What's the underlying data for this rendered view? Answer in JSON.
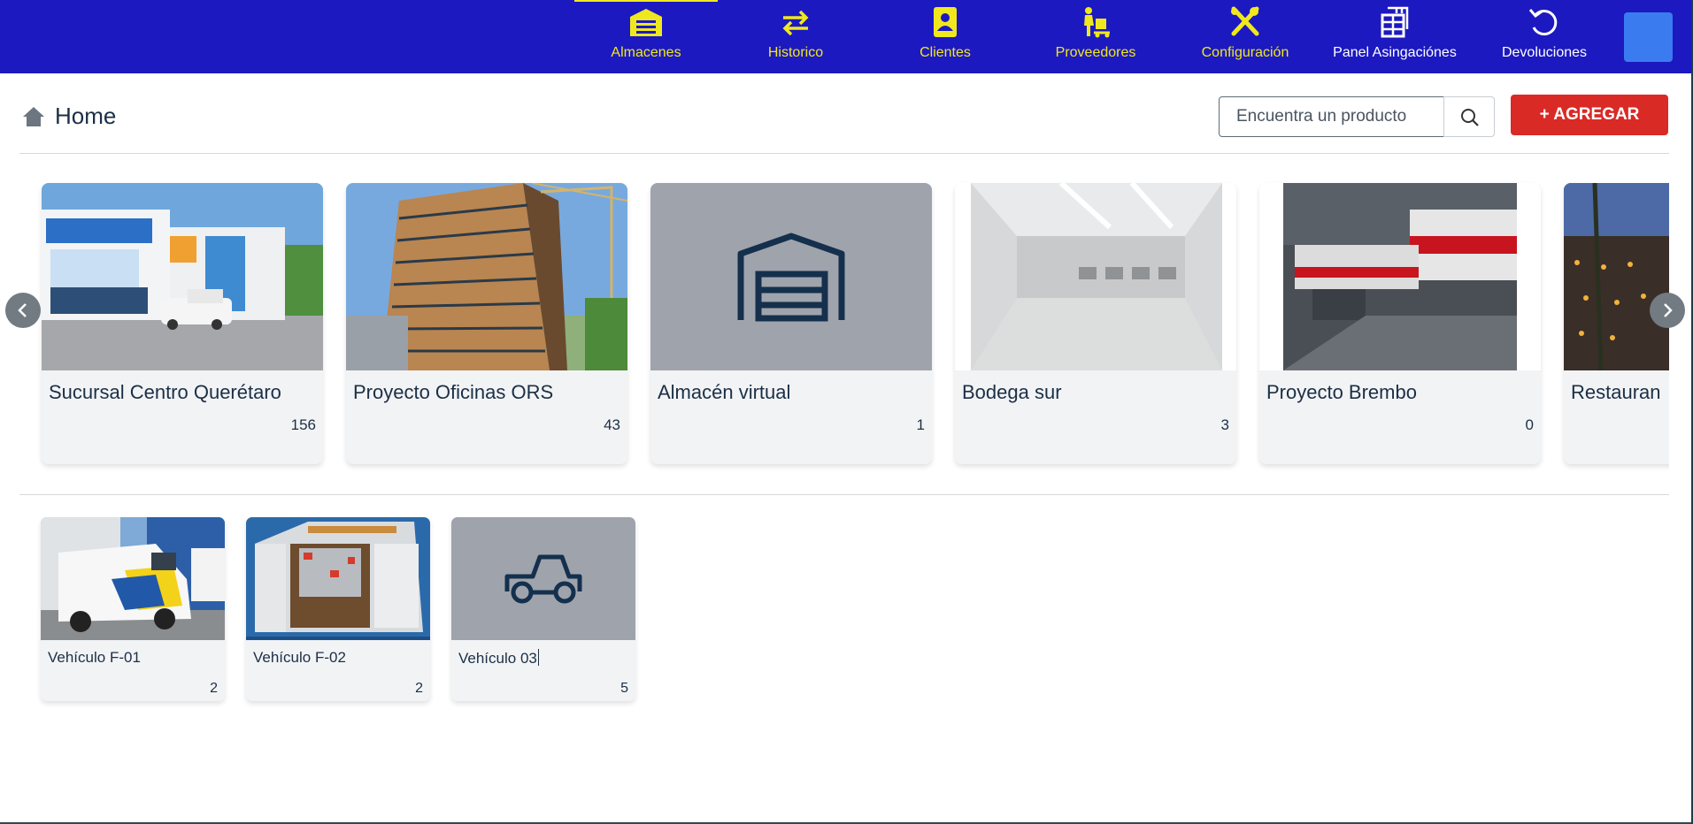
{
  "nav": {
    "items": [
      {
        "label": "Almacenes",
        "icon": "garage-icon",
        "active": true
      },
      {
        "label": "Historico",
        "icon": "transfer-arrows-icon"
      },
      {
        "label": "Clientes",
        "icon": "contact-book-icon"
      },
      {
        "label": "Proveedores",
        "icon": "supplier-dolly-icon"
      },
      {
        "label": "Configuración",
        "icon": "tools-icon"
      },
      {
        "label": "Panel Asingaciónes",
        "icon": "shelf-panel-icon"
      },
      {
        "label": "Devoluciones",
        "icon": "undo-arrow-icon"
      }
    ],
    "avatar_color": "#3a7cf0"
  },
  "header": {
    "title": "Home",
    "search_placeholder": "Encuentra un producto",
    "add_label": "AGREGAR"
  },
  "warehouses": [
    {
      "name": "Sucursal Centro Querétaro",
      "count": "156",
      "image": "storefront-photo"
    },
    {
      "name": "Proyecto Oficinas ORS",
      "count": "43",
      "image": "building-construction-photo"
    },
    {
      "name": "Almacén virtual",
      "count": "1",
      "image": "garage-icon"
    },
    {
      "name": "Bodega sur",
      "count": "3",
      "image": "empty-warehouse-photo"
    },
    {
      "name": "Proyecto Brembo",
      "count": "0",
      "image": "factory-photo"
    },
    {
      "name": "Restauran",
      "count": "",
      "image": "restaurant-night-photo"
    }
  ],
  "vehicles": [
    {
      "name": "Vehículo F-01",
      "count": "2",
      "image": "white-van-photo"
    },
    {
      "name": "Vehículo F-02",
      "count": "2",
      "image": "van-interior-photo"
    },
    {
      "name": "Vehículo 03",
      "count": "5",
      "image": "car-icon"
    }
  ],
  "colors": {
    "nav_bg": "#1c19c0",
    "nav_active": "#f0e81e",
    "add_button": "#da2a26",
    "card_bg": "#f2f3f5",
    "icon_placeholder_bg": "#9fa3ac",
    "text_dark": "#1b2f45"
  }
}
